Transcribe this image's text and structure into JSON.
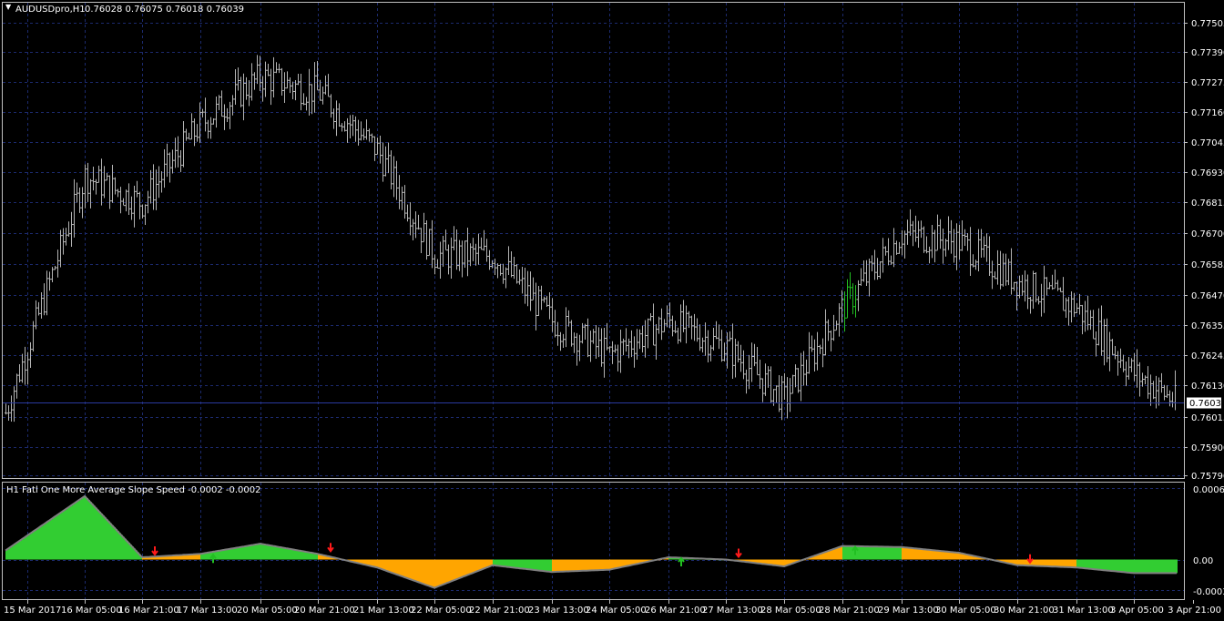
{
  "main": {
    "symbol_label": "AUDUSDpro,H1",
    "ohlc_label": "0.76028 0.76075 0.76018 0.76039",
    "y_ticks": [
      "0.77505",
      "0.77390",
      "0.77275",
      "0.77160",
      "0.77045",
      "0.76930",
      "0.76815",
      "0.76700",
      "0.76585",
      "0.76470",
      "0.76355",
      "0.76245",
      "0.76130",
      "0.76015",
      "0.75900",
      "0.75790"
    ],
    "current_price": "0.76039"
  },
  "indicator": {
    "title": "H1 Fatl One More Average Slope Speed -0.0002 -0.0002",
    "y_ticks": [
      "0.0006",
      "0.00",
      "-0.0003"
    ]
  },
  "x_ticks": [
    "15 Mar 2017",
    "16 Mar 05:00",
    "16 Mar 21:00",
    "17 Mar 13:00",
    "20 Mar 05:00",
    "20 Mar 21:00",
    "21 Mar 13:00",
    "22 Mar 05:00",
    "22 Mar 21:00",
    "23 Mar 13:00",
    "24 Mar 05:00",
    "26 Mar 21:00",
    "27 Mar 13:00",
    "28 Mar 05:00",
    "28 Mar 21:00",
    "29 Mar 13:00",
    "30 Mar 05:00",
    "30 Mar 21:00",
    "31 Mar 13:00",
    "3 Apr 05:00",
    "3 Apr 21:00"
  ],
  "colors": {
    "background": "#000000",
    "grid": "#1c2a6e",
    "frame": "#c0c0c0",
    "bars": "#b4b4b4",
    "up_bar": "#22c022",
    "price_line": "#2a3aa0",
    "hist_up": "#32cd32",
    "hist_down": "#ffa500",
    "hist_line": "#808080",
    "arrow_up": "#22c022",
    "arrow_down": "#ff1a1a"
  },
  "chart_data": [
    {
      "type": "ohlc",
      "title": "AUDUSDpro,H1",
      "ylim": [
        0.7575,
        0.7756
      ],
      "x": [
        "15 Mar 2017",
        "16 Mar 05:00",
        "16 Mar 21:00",
        "17 Mar 13:00",
        "20 Mar 05:00",
        "20 Mar 21:00",
        "21 Mar 13:00",
        "22 Mar 05:00",
        "22 Mar 21:00",
        "23 Mar 13:00",
        "24 Mar 05:00",
        "26 Mar 21:00",
        "27 Mar 13:00",
        "28 Mar 05:00",
        "28 Mar 21:00",
        "29 Mar 13:00",
        "30 Mar 05:00",
        "30 Mar 21:00",
        "31 Mar 13:00",
        "3 Apr 05:00",
        "3 Apr 21:00"
      ],
      "y": [
        0.76,
        0.769,
        0.768,
        0.771,
        0.7728,
        0.7722,
        0.77,
        0.766,
        0.766,
        0.7635,
        0.7622,
        0.7635,
        0.7625,
        0.7605,
        0.764,
        0.7668,
        0.7665,
        0.765,
        0.764,
        0.7615,
        0.7604
      ],
      "last": 0.76039
    },
    {
      "type": "area",
      "title": "H1 Fatl One More Average Slope Speed",
      "ylim": [
        -0.00035,
        0.00068
      ],
      "x": [
        "15 Mar 2017",
        "16 Mar 05:00",
        "16 Mar 21:00",
        "17 Mar 13:00",
        "20 Mar 05:00",
        "20 Mar 21:00",
        "21 Mar 13:00",
        "22 Mar 05:00",
        "22 Mar 21:00",
        "23 Mar 13:00",
        "24 Mar 05:00",
        "26 Mar 21:00",
        "27 Mar 13:00",
        "28 Mar 05:00",
        "28 Mar 21:00",
        "29 Mar 13:00",
        "30 Mar 05:00",
        "30 Mar 21:00",
        "31 Mar 13:00",
        "3 Apr 05:00",
        "3 Apr 21:00"
      ],
      "series": [
        {
          "values": [
            8e-05,
            0.00056,
            2e-05,
            5e-05,
            0.00014,
            5e-05,
            -7e-05,
            -0.00025,
            -5e-05,
            -0.00011,
            -9e-05,
            2e-05,
            0.0,
            -6e-05,
            0.00012,
            0.00011,
            6e-05,
            -5e-05,
            -7e-05,
            -0.00012,
            -0.00012
          ],
          "colors": [
            "up",
            "up",
            "down",
            "up",
            "up",
            "down",
            "down",
            "down",
            "up",
            "down",
            "down",
            "up",
            "down",
            "down",
            "up",
            "down",
            "down",
            "down",
            "up",
            "up",
            "up"
          ]
        }
      ],
      "signals": [
        {
          "x": "16 Mar 21:00",
          "dir": "down"
        },
        {
          "x": "17 Mar 13:00",
          "dir": "up"
        },
        {
          "x": "20 Mar 21:00",
          "dir": "down"
        },
        {
          "x": "26 Mar 21:00",
          "dir": "up"
        },
        {
          "x": "27 Mar 13:00",
          "dir": "down"
        },
        {
          "x": "28 Mar 21:00",
          "dir": "up"
        },
        {
          "x": "30 Mar 21:00",
          "dir": "down"
        }
      ]
    }
  ]
}
